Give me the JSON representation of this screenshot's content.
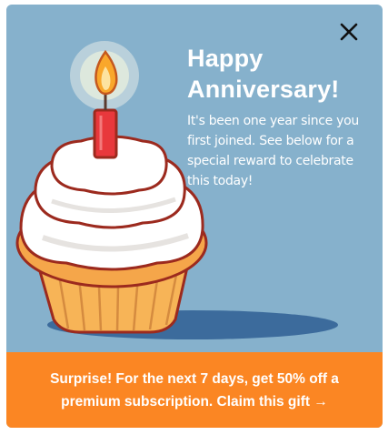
{
  "dialog": {
    "title_line1": "Happy",
    "title_line2": "Anniversary!",
    "message": "It's been one year since you first joined.  See below for a special reward to celebrate this today!",
    "close_icon": "close-icon",
    "cta_text": "Surprise! For the next 7 days, get 50% off a premium subscription. Claim this gift →",
    "illustration": "birthday-cupcake-with-candle"
  },
  "colors": {
    "background": "#86b1cc",
    "banner": "#fb8623",
    "text": "#ffffff",
    "frosting": "#ffffff",
    "cake": "#f5a64a",
    "wrapper": "#f7b55a",
    "outline": "#9c2a1e",
    "candle": "#e8383c",
    "flame": "#f9a72b"
  }
}
